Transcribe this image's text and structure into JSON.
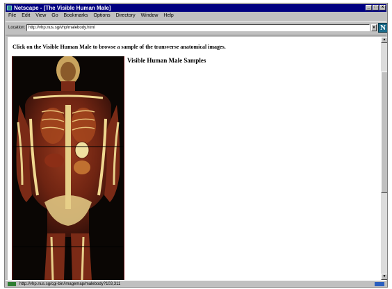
{
  "window": {
    "title": "Netscape - [The Visible Human Male]"
  },
  "menu": [
    "File",
    "Edit",
    "View",
    "Go",
    "Bookmarks",
    "Options",
    "Directory",
    "Window",
    "Help"
  ],
  "location": {
    "label": "Location:",
    "url": "http://vhp.nus.sg/vhp/malebody.html"
  },
  "page": {
    "instruction": "Click on the Visible Human Male to browse a sample of the transverse anatomical images.",
    "samples_heading": "Visible Human Male Samples"
  },
  "status": {
    "text": "http://vhp.nus.sg/cgi-bin/imagemap/malebody?103,311"
  },
  "colors": {
    "titlebar": "#000080",
    "chrome": "#c0c0c0",
    "brand": "#1b6b8a"
  },
  "icons": [
    "netscape-app-icon",
    "minimize-icon",
    "maximize-icon",
    "close-icon",
    "netscape-logo-icon",
    "dropdown-arrow-icon",
    "scroll-up-icon",
    "scroll-down-icon",
    "security-key-icon",
    "mail-icon"
  ]
}
